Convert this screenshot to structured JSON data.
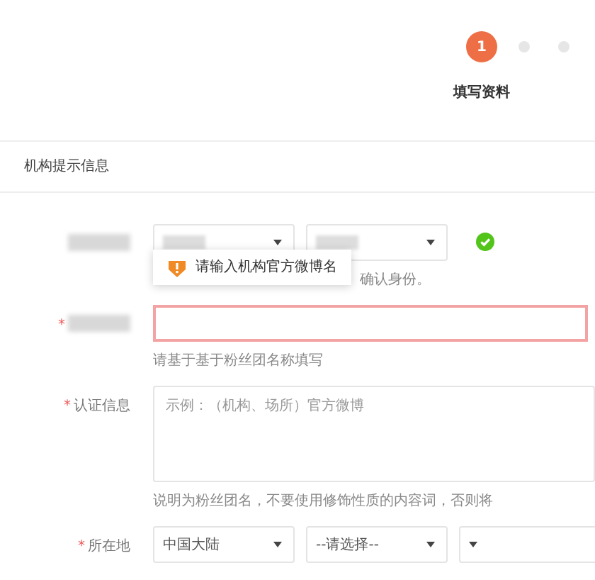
{
  "steps": [
    {
      "number": "1",
      "label": "填写资料",
      "selected": true
    },
    {
      "selected": false
    },
    {
      "selected": false
    }
  ],
  "section_title": "机构提示信息",
  "rows": [
    {
      "kind": "selects",
      "label_redacted": true,
      "selects": [
        {
          "redacted": true
        },
        {
          "redacted": true
        }
      ],
      "valid": true,
      "hint": "确认身份。",
      "tooltip": {
        "text": "请输入机构官方微博名"
      }
    },
    {
      "kind": "input",
      "required_mark": "*",
      "label_redacted": true,
      "error": true,
      "hint": "请基于基于粉丝团名称填写"
    },
    {
      "kind": "textarea",
      "required_mark": "*",
      "label": "认证信息",
      "placeholder": "示例：（机构、场所）官方微博",
      "hint": "说明为粉丝团名，不要使用修饰性质的内容词，否则将"
    },
    {
      "kind": "selects",
      "required_mark": "*",
      "label": "所在地",
      "selects": [
        {
          "value": "中国大陆"
        },
        {
          "value": "--请选择--"
        },
        {
          "cut_off": true
        }
      ]
    }
  ]
}
